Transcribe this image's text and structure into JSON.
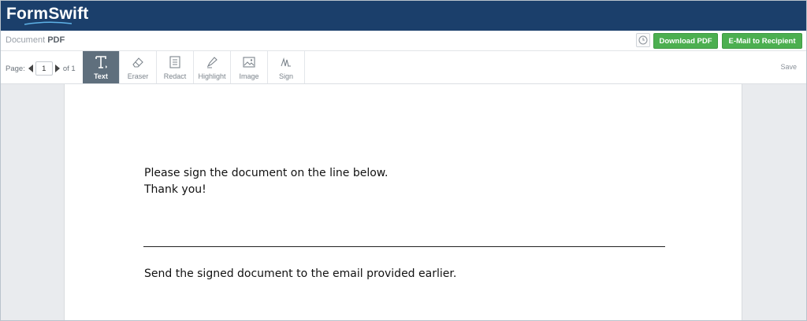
{
  "brand": {
    "name_part1": "Form",
    "name_part2": "Swift"
  },
  "title_row": {
    "doc_label": "Document",
    "doc_type": "PDF",
    "download_label": "Download PDF",
    "email_label": "E-Mail to Recipient"
  },
  "toolbar": {
    "page_label": "Page:",
    "page_value": "1",
    "page_of": "of 1",
    "tools": [
      {
        "label": "Text",
        "icon": "text-tool-icon"
      },
      {
        "label": "Eraser",
        "icon": "eraser-icon"
      },
      {
        "label": "Redact",
        "icon": "redact-icon"
      },
      {
        "label": "Highlight",
        "icon": "highlighter-icon"
      },
      {
        "label": "Image",
        "icon": "image-icon"
      },
      {
        "label": "Sign",
        "icon": "signature-icon"
      }
    ],
    "active_tool": "Text",
    "save_label": "Save"
  },
  "document": {
    "line1": "Please sign the document on the line below.",
    "line2": "Thank you!",
    "line3": "Send the signed document to the email provided earlier."
  },
  "colors": {
    "brand_bar": "#1b3f6b",
    "accent_green": "#4caf50",
    "active_tool": "#5f6f7d"
  }
}
